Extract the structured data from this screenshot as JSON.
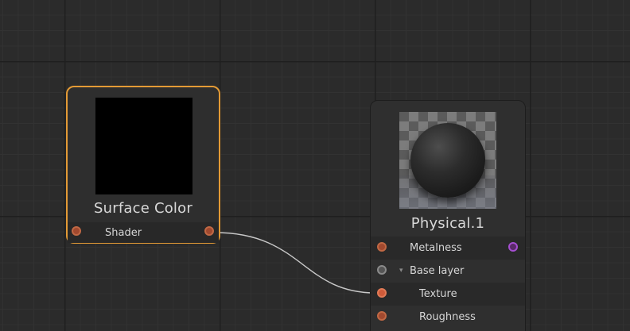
{
  "nodes": {
    "surface": {
      "title": "Surface Color",
      "output_label": "Shader",
      "accent": "#e39a35"
    },
    "physical": {
      "title": "Physical.1",
      "rows": [
        {
          "label": "Metalness"
        },
        {
          "label": "Base layer"
        },
        {
          "label": "Texture"
        },
        {
          "label": "Roughness"
        }
      ]
    }
  },
  "colors": {
    "background": "#2b2b2b",
    "port_orange": "#c06844",
    "port_purple": "#a54ed0",
    "wire": "#c8c8c8"
  },
  "icons": {
    "expander": "▾"
  }
}
